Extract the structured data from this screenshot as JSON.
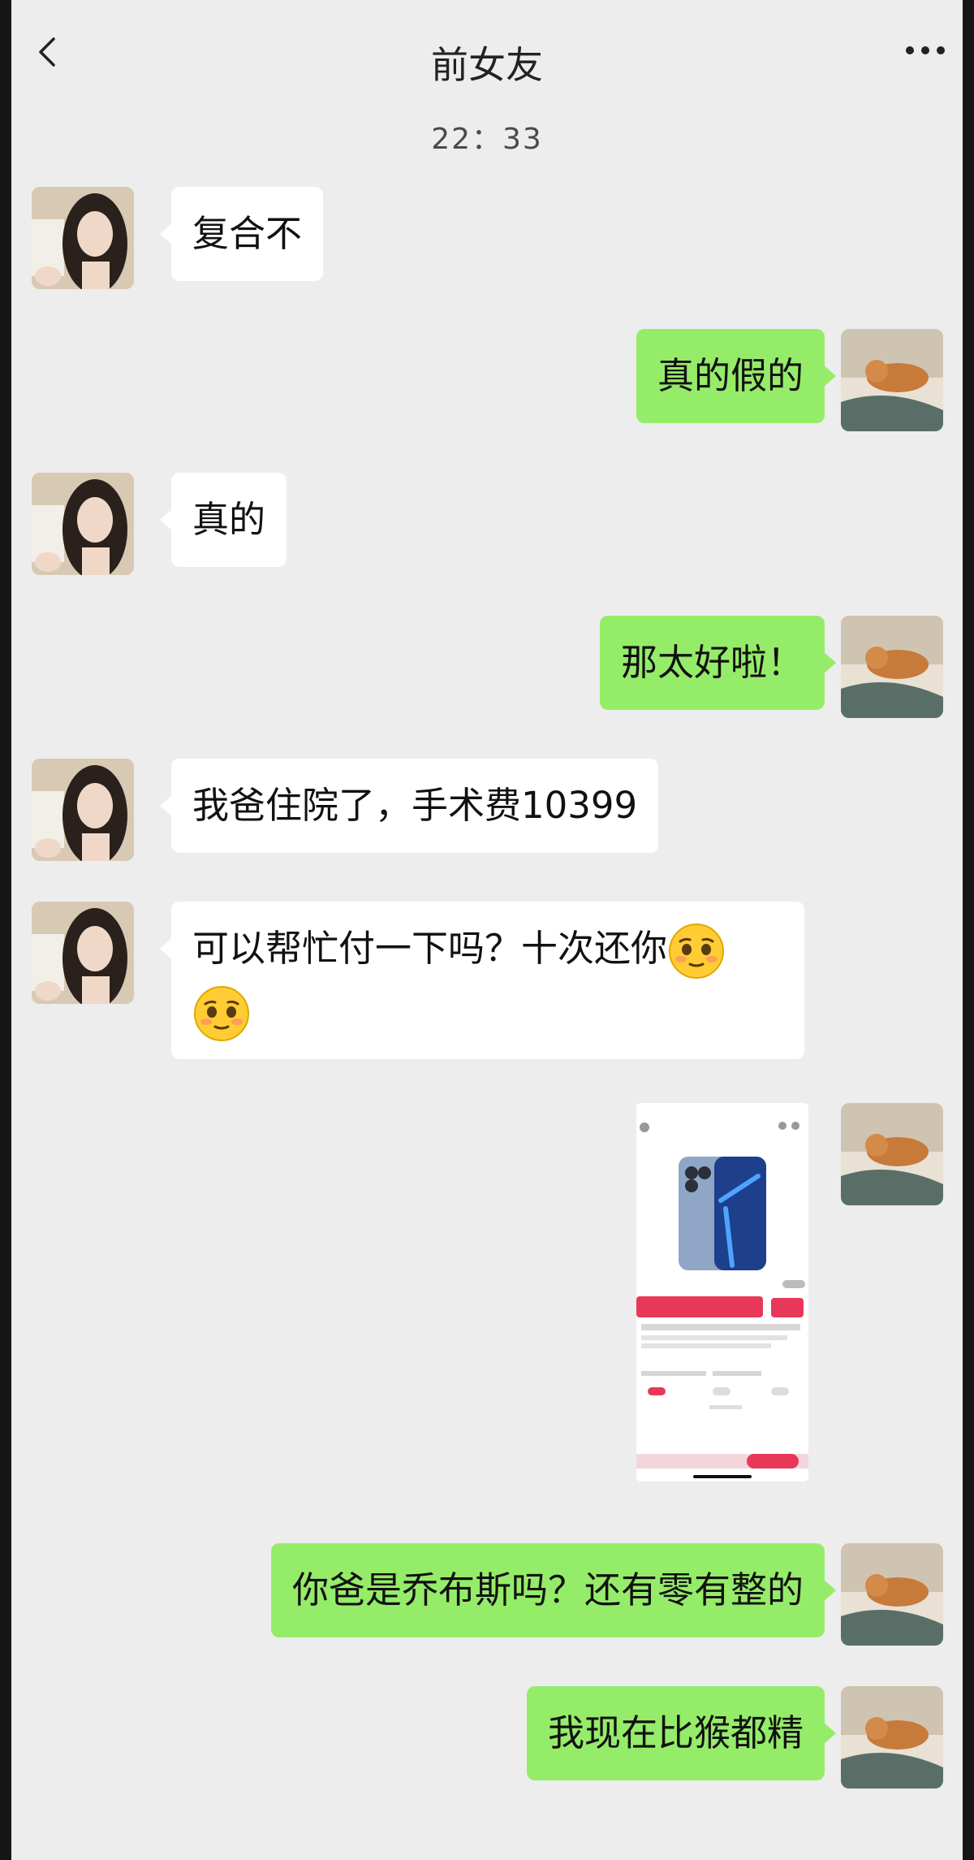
{
  "header": {
    "title": "前女友"
  },
  "chat": {
    "timestamp": "22：33",
    "messages": [
      {
        "from": "them",
        "text": "复合不"
      },
      {
        "from": "me",
        "text": "真的假的"
      },
      {
        "from": "them",
        "text": "真的"
      },
      {
        "from": "me",
        "text": "那太好啦！"
      },
      {
        "from": "them",
        "text": "我爸住院了，手术费10399"
      },
      {
        "from": "them",
        "text": "可以帮忙付一下吗？十次还你",
        "emoji": "pleading-face"
      },
      {
        "from": "me",
        "type": "image",
        "image": "screenshot of phone product page"
      },
      {
        "from": "me",
        "text": "你爸是乔布斯吗？还有零有整的"
      },
      {
        "from": "me",
        "text": "我现在比猴都精"
      }
    ]
  },
  "colors": {
    "background": "#ededed",
    "incoming_bubble": "#ffffff",
    "outgoing_bubble": "#95ec69"
  },
  "icons": {
    "back": "chevron-left-icon",
    "more": "more-dots-icon",
    "emoji": "pleading-face-icon"
  }
}
